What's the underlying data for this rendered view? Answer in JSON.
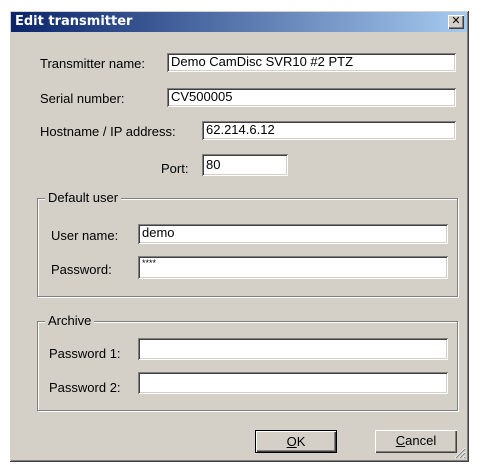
{
  "window": {
    "title": "Edit transmitter",
    "close_glyph": "✕"
  },
  "fields": {
    "transmitter_name": {
      "label": "Transmitter name:",
      "value": "Demo CamDisc SVR10 #2 PTZ"
    },
    "serial_number": {
      "label": "Serial number:",
      "value": "CV500005"
    },
    "hostname": {
      "label": "Hostname / IP address:",
      "value": "62.214.6.12"
    },
    "port": {
      "label": "Port:",
      "value": "80"
    }
  },
  "default_user": {
    "legend": "Default user",
    "user_name": {
      "label": "User name:",
      "value": "demo"
    },
    "password": {
      "label": "Password:",
      "value": "****"
    }
  },
  "archive": {
    "legend": "Archive",
    "password1": {
      "label": "Password 1:",
      "value": ""
    },
    "password2": {
      "label": "Password 2:",
      "value": ""
    }
  },
  "buttons": {
    "ok": "OK",
    "ok_mnemonic": "O",
    "ok_rest": "K",
    "cancel": "Cancel",
    "cancel_mnemonic": "C",
    "cancel_rest": "ancel"
  }
}
